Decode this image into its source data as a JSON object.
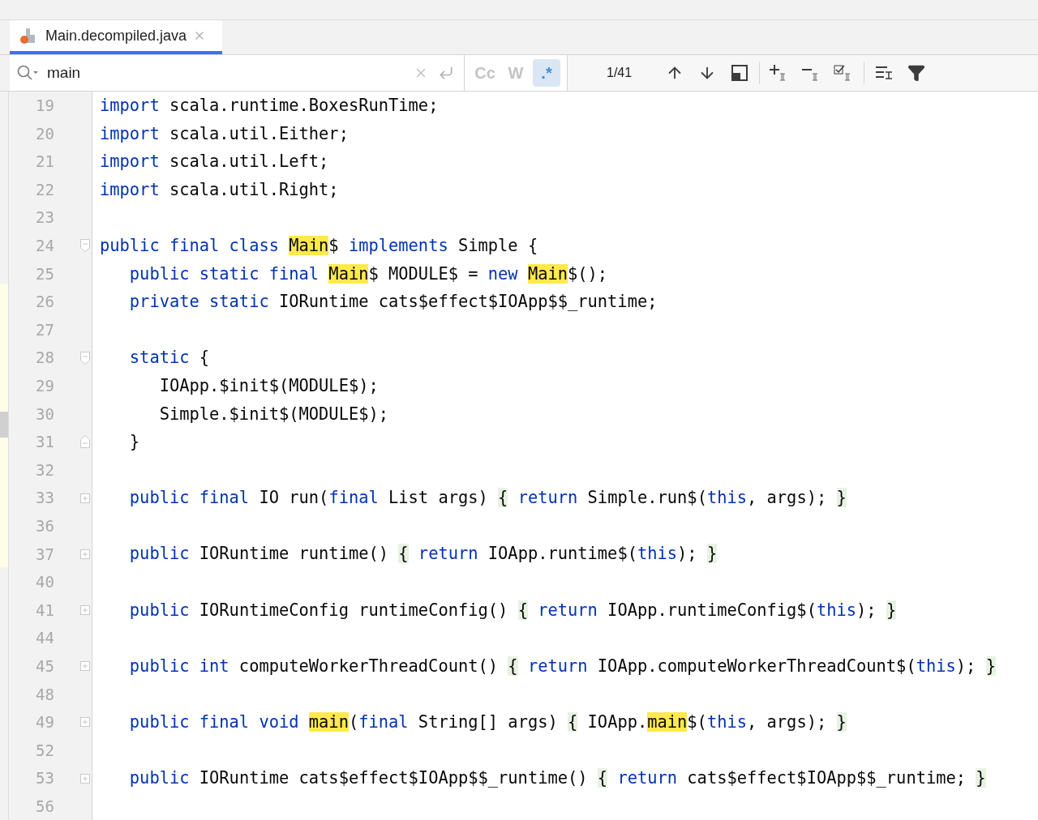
{
  "tabs": [
    {
      "label": "Main.decompiled.java",
      "selected": true
    }
  ],
  "search": {
    "value": "main",
    "options": [
      {
        "label": "Cc",
        "selected": false
      },
      {
        "label": "W",
        "selected": false
      },
      {
        "label": ".*",
        "selected": true
      }
    ],
    "count": "1/41"
  },
  "lines": [
    {
      "number": "19",
      "kind": "plain",
      "tokens": [
        {
          "kind": "kw",
          "text": "import"
        },
        {
          "kind": "plain",
          "text": " scala.runtime.BoxesRunTime;"
        }
      ]
    },
    {
      "number": "20",
      "kind": "plain",
      "tokens": [
        {
          "kind": "kw",
          "text": "import"
        },
        {
          "kind": "plain",
          "text": " scala.util.Either;"
        }
      ]
    },
    {
      "number": "21",
      "kind": "plain",
      "tokens": [
        {
          "kind": "kw",
          "text": "import"
        },
        {
          "kind": "plain",
          "text": " scala.util.Left;"
        }
      ]
    },
    {
      "number": "22",
      "kind": "plain",
      "tokens": [
        {
          "kind": "kw",
          "text": "import"
        },
        {
          "kind": "plain",
          "text": " scala.util.Right;"
        }
      ]
    },
    {
      "number": "23",
      "kind": "plain"
    },
    {
      "number": "24",
      "kind": "fold-start",
      "tokens": [
        {
          "kind": "kw",
          "text": "public final class "
        },
        {
          "kind": "match",
          "text": "Main"
        },
        {
          "kind": "plain",
          "text": "$ "
        },
        {
          "kind": "kw",
          "text": "implements"
        },
        {
          "kind": "plain",
          "text": " Simple {"
        }
      ]
    },
    {
      "number": "25",
      "kind": "plain",
      "tokens": [
        {
          "kind": "kw",
          "text": "   public static final "
        },
        {
          "kind": "match",
          "text": "Main"
        },
        {
          "kind": "plain",
          "text": "$ MODULE$ = "
        },
        {
          "kind": "kw",
          "text": "new "
        },
        {
          "kind": "match",
          "text": "Main"
        },
        {
          "kind": "plain",
          "text": "$();"
        }
      ]
    },
    {
      "number": "26",
      "kind": "plain",
      "tokens": [
        {
          "kind": "kw",
          "text": "   private static"
        },
        {
          "kind": "plain",
          "text": " IORuntime cats$effect$IOApp$$_runtime;"
        }
      ]
    },
    {
      "number": "27",
      "kind": "plain"
    },
    {
      "number": "28",
      "kind": "fold-start",
      "tokens": [
        {
          "kind": "kw",
          "text": "   static"
        },
        {
          "kind": "plain",
          "text": " {"
        }
      ]
    },
    {
      "number": "29",
      "kind": "plain",
      "tokens": [
        {
          "kind": "plain",
          "text": "      IOApp.$init$(MODULE$);"
        }
      ]
    },
    {
      "number": "30",
      "kind": "plain",
      "tokens": [
        {
          "kind": "plain",
          "text": "      Simple.$init$(MODULE$);"
        }
      ]
    },
    {
      "number": "31",
      "kind": "fold-end",
      "tokens": [
        {
          "kind": "plain",
          "text": "   }"
        }
      ]
    },
    {
      "number": "32",
      "kind": "plain"
    },
    {
      "number": "33",
      "kind": "folded",
      "tokens": [
        {
          "kind": "kw",
          "text": "   public final"
        },
        {
          "kind": "plain",
          "text": " IO run("
        },
        {
          "kind": "kw",
          "text": "final"
        },
        {
          "kind": "plain",
          "text": " List args) "
        },
        {
          "kind": "brace",
          "text": "{"
        },
        {
          "kind": "kw",
          "text": " return"
        },
        {
          "kind": "plain",
          "text": " Simple.run$("
        },
        {
          "kind": "kw",
          "text": "this"
        },
        {
          "kind": "plain",
          "text": ", args); "
        },
        {
          "kind": "brace",
          "text": "}"
        }
      ]
    },
    {
      "number": "36",
      "kind": "plain"
    },
    {
      "number": "37",
      "kind": "folded",
      "tokens": [
        {
          "kind": "kw",
          "text": "   public"
        },
        {
          "kind": "plain",
          "text": " IORuntime runtime() "
        },
        {
          "kind": "brace",
          "text": "{"
        },
        {
          "kind": "kw",
          "text": " return"
        },
        {
          "kind": "plain",
          "text": " IOApp.runtime$("
        },
        {
          "kind": "kw",
          "text": "this"
        },
        {
          "kind": "plain",
          "text": "); "
        },
        {
          "kind": "brace",
          "text": "}"
        }
      ]
    },
    {
      "number": "40",
      "kind": "plain"
    },
    {
      "number": "41",
      "kind": "folded",
      "tokens": [
        {
          "kind": "kw",
          "text": "   public"
        },
        {
          "kind": "plain",
          "text": " IORuntimeConfig runtimeConfig() "
        },
        {
          "kind": "brace",
          "text": "{"
        },
        {
          "kind": "kw",
          "text": " return"
        },
        {
          "kind": "plain",
          "text": " IOApp.runtimeConfig$("
        },
        {
          "kind": "kw",
          "text": "this"
        },
        {
          "kind": "plain",
          "text": "); "
        },
        {
          "kind": "brace",
          "text": "}"
        }
      ]
    },
    {
      "number": "44",
      "kind": "plain"
    },
    {
      "number": "45",
      "kind": "folded",
      "tokens": [
        {
          "kind": "kw",
          "text": "   public int"
        },
        {
          "kind": "plain",
          "text": " computeWorkerThreadCount() "
        },
        {
          "kind": "brace",
          "text": "{"
        },
        {
          "kind": "kw",
          "text": " return"
        },
        {
          "kind": "plain",
          "text": " IOApp.computeWorkerThreadCount$("
        },
        {
          "kind": "kw",
          "text": "this"
        },
        {
          "kind": "plain",
          "text": "); "
        },
        {
          "kind": "brace",
          "text": "}"
        }
      ]
    },
    {
      "number": "48",
      "kind": "plain"
    },
    {
      "number": "49",
      "kind": "folded",
      "tokens": [
        {
          "kind": "kw",
          "text": "   public final void "
        },
        {
          "kind": "match",
          "text": "main"
        },
        {
          "kind": "plain",
          "text": "("
        },
        {
          "kind": "kw",
          "text": "final"
        },
        {
          "kind": "plain",
          "text": " String[] args) "
        },
        {
          "kind": "brace",
          "text": "{"
        },
        {
          "kind": "plain",
          "text": " IOApp."
        },
        {
          "kind": "match",
          "text": "main"
        },
        {
          "kind": "plain",
          "text": "$("
        },
        {
          "kind": "kw",
          "text": "this"
        },
        {
          "kind": "plain",
          "text": ", args); "
        },
        {
          "kind": "brace",
          "text": "}"
        }
      ]
    },
    {
      "number": "52",
      "kind": "plain"
    },
    {
      "number": "53",
      "kind": "folded",
      "tokens": [
        {
          "kind": "kw",
          "text": "   public"
        },
        {
          "kind": "plain",
          "text": " IORuntime cats$effect$IOApp$$_runtime() "
        },
        {
          "kind": "brace",
          "text": "{"
        },
        {
          "kind": "kw",
          "text": " return"
        },
        {
          "kind": "plain",
          "text": " cats$effect$IOApp$$_runtime; "
        },
        {
          "kind": "brace",
          "text": "}"
        }
      ]
    },
    {
      "number": "56",
      "kind": "plain"
    }
  ]
}
